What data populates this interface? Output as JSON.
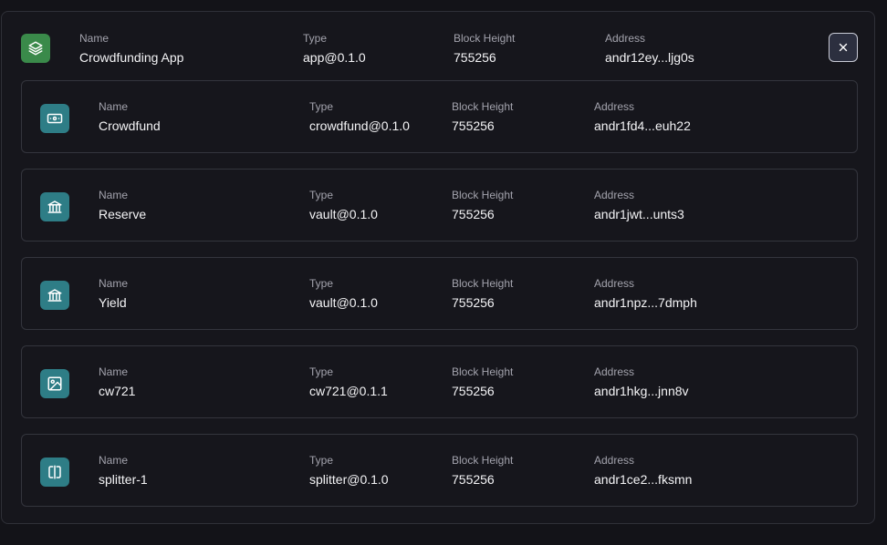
{
  "colors": {
    "background": "#131318",
    "app_icon": "#3a8a4a",
    "component_icon": "#2e7d86",
    "border": "#34353d"
  },
  "labels": {
    "name": "Name",
    "type": "Type",
    "block_height": "Block Height",
    "address": "Address"
  },
  "app": {
    "icon": "layers-icon",
    "name": "Crowdfunding App",
    "type": "app@0.1.0",
    "block_height": "755256",
    "address": "andr12ey...ljg0s",
    "close_icon": "close-icon"
  },
  "components": [
    {
      "icon": "banknote-icon",
      "name": "Crowdfund",
      "type": "crowdfund@0.1.0",
      "block_height": "755256",
      "address": "andr1fd4...euh22"
    },
    {
      "icon": "bank-icon",
      "name": "Reserve",
      "type": "vault@0.1.0",
      "block_height": "755256",
      "address": "andr1jwt...unts3"
    },
    {
      "icon": "bank-icon",
      "name": "Yield",
      "type": "vault@0.1.0",
      "block_height": "755256",
      "address": "andr1npz...7dmph"
    },
    {
      "icon": "image-icon",
      "name": "cw721",
      "type": "cw721@0.1.1",
      "block_height": "755256",
      "address": "andr1hkg...jnn8v"
    },
    {
      "icon": "splitter-icon",
      "name": "splitter-1",
      "type": "splitter@0.1.0",
      "block_height": "755256",
      "address": "andr1ce2...fksmn"
    }
  ]
}
